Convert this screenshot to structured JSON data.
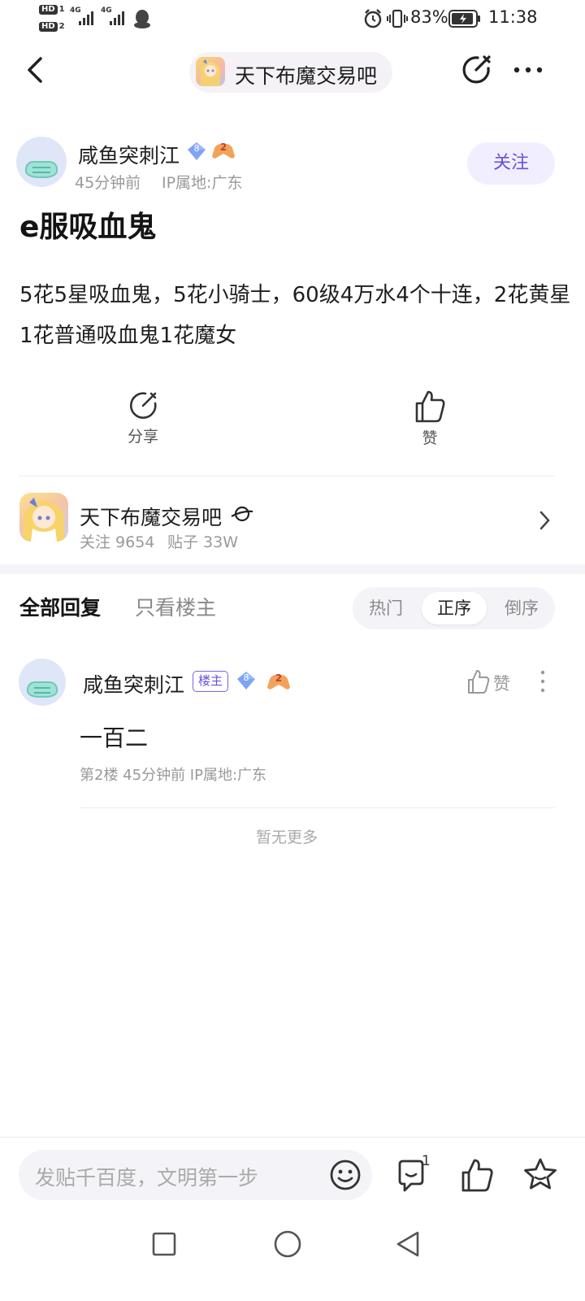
{
  "status_bar": {
    "sim1": "HD",
    "sim1_num": "1",
    "sim2": "HD",
    "sim2_num": "2",
    "network1": "4G",
    "network2": "4G",
    "battery": "83%",
    "time": "11:38"
  },
  "header": {
    "forum_name": "天下布魔交易吧",
    "icons": [
      "back-icon",
      "share-icon",
      "more-icon"
    ]
  },
  "post": {
    "author": {
      "name": "咸鱼突刺江",
      "level": "8",
      "badge2": "2",
      "time": "45分钟前",
      "ip": "IP属地:广东"
    },
    "follow_label": "关注",
    "title": "e服吸血鬼",
    "body": "5花5星吸血鬼，5花小骑士，60级4万水4个十连，2花黄星1花普通吸血鬼1花魔女",
    "actions": {
      "share_label": "分享",
      "like_label": "赞"
    }
  },
  "forum_card": {
    "name": "天下布魔交易吧",
    "follow_count_label": "关注 9654",
    "post_count_label": "贴子 33W"
  },
  "replies_header": {
    "tab_all": "全部回复",
    "tab_op_only": "只看楼主",
    "sort_options": [
      "热门",
      "正序",
      "倒序"
    ],
    "sort_active": "正序"
  },
  "replies": [
    {
      "author": "咸鱼突刺江",
      "op_badge": "楼主",
      "level": "8",
      "badge2": "2",
      "like_label": "赞",
      "content": "一百二",
      "meta": "第2楼   45分钟前   IP属地:广东"
    }
  ],
  "no_more": "暂无更多",
  "bottom": {
    "input_placeholder": "发贴千百度，文明第一步",
    "comment_count": "1"
  },
  "colors": {
    "accent": "#6b4fdc",
    "follow_bg": "#f1efff",
    "muted_text": "#999999"
  }
}
